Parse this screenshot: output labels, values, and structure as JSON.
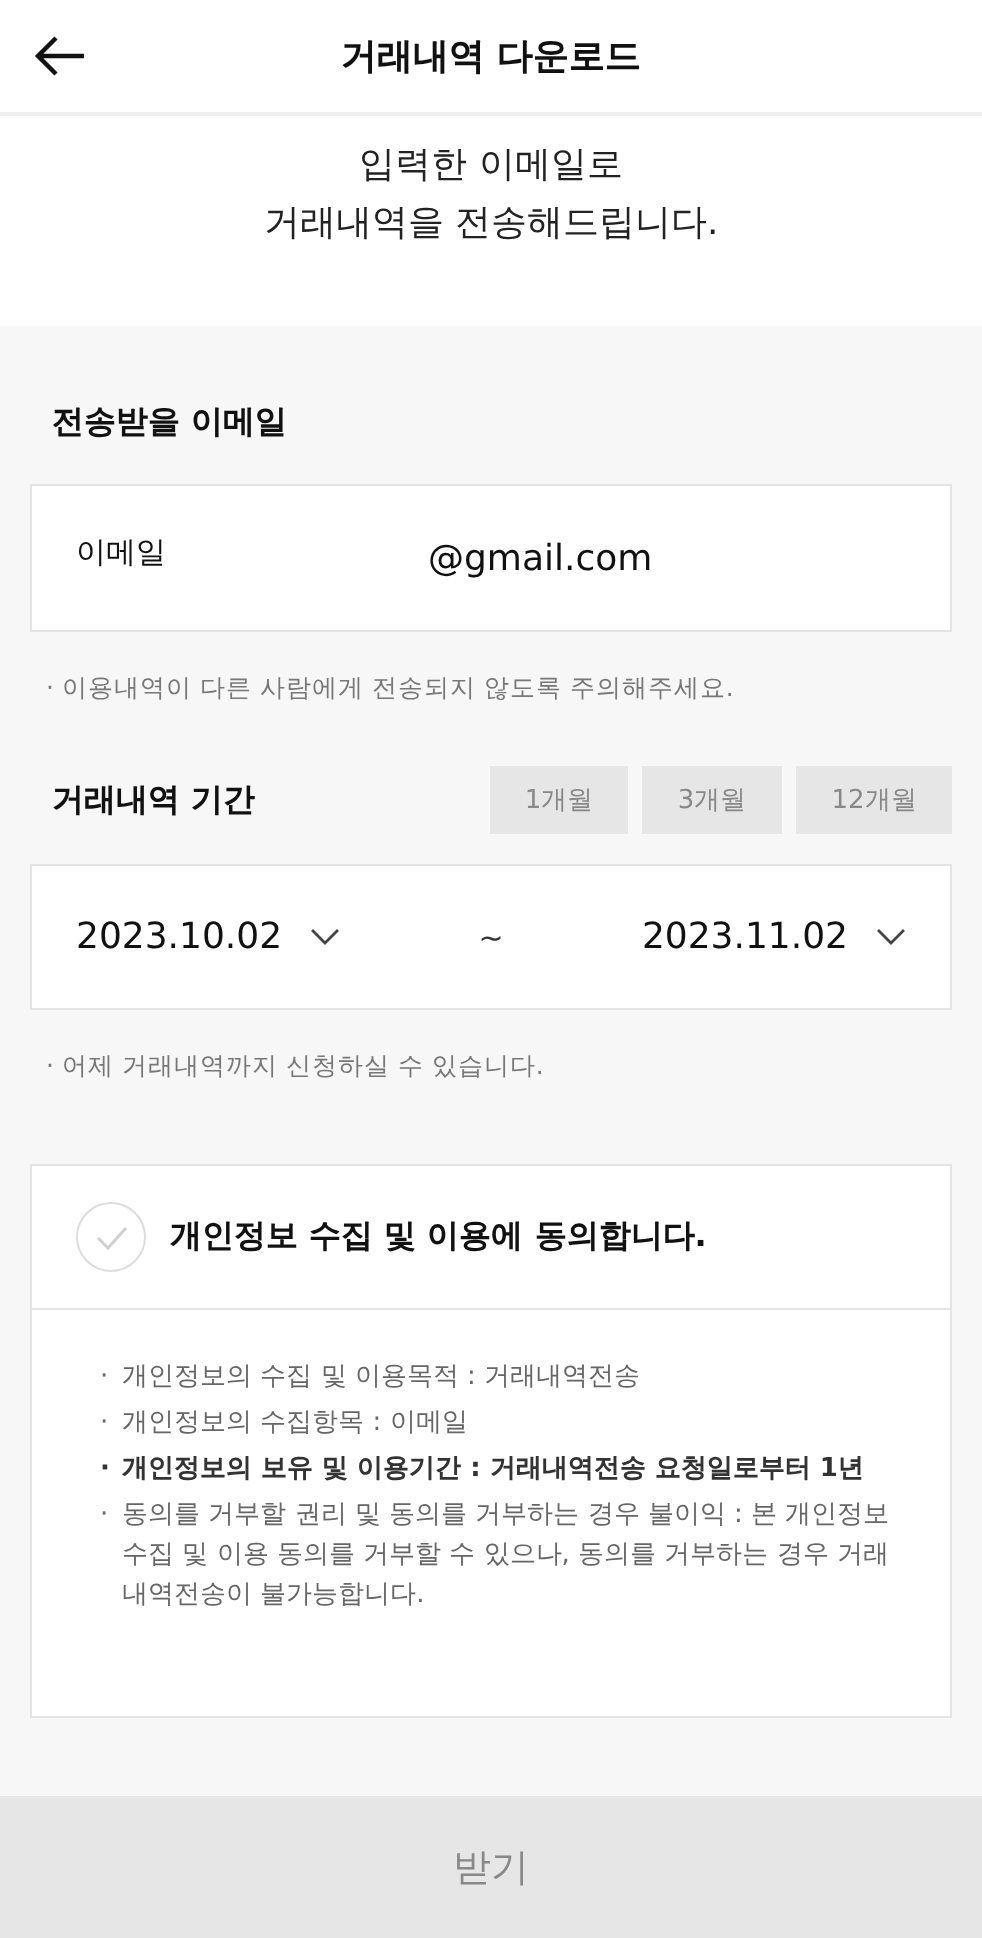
{
  "header": {
    "title": "거래내역 다운로드"
  },
  "intro": [
    "입력한 이메일로",
    "거래내역을 전송해드립니다."
  ],
  "email_section": {
    "title": "전송받을 이메일",
    "label": "이메일",
    "value": "@gmail.com",
    "note": "·  이용내역이 다른 사람에게 전송되지 않도록 주의해주세요."
  },
  "period_section": {
    "title": "거래내역 기간",
    "presets": [
      {
        "label": "1개월",
        "selected": false
      },
      {
        "label": "3개월",
        "selected": false
      },
      {
        "label": "12개월",
        "selected": false
      }
    ],
    "start_date": "2023.10.02",
    "separator": "~",
    "end_date": "2023.11.02",
    "note": "· 어제 거래내역까지 신청하실 수 있습니다."
  },
  "consent": {
    "label": "개인정보 수집 및 이용에 동의합니다.",
    "checked": false,
    "items": [
      {
        "bullet": "·",
        "text": "개인정보의 수집 및 이용목적 : 거래내역전송",
        "emphasis": false
      },
      {
        "bullet": "·",
        "text": "개인정보의 수집항목 : 이메일",
        "emphasis": false
      },
      {
        "bullet": "·",
        "text": "개인정보의 보유 및 이용기간 : 거래내역전송 요청일로부터 1년",
        "emphasis": true
      },
      {
        "bullet": "·",
        "text": "동의를 거부할 권리 및 동의를 거부하는 경우 불이익 : 본 개인정보수집 및 이용 동의를 거부할 수 있으나, 동의를 거부하는 경우 거래내역전송이 불가능합니다.",
        "emphasis": false
      }
    ]
  },
  "submit": {
    "label": "받기",
    "disabled": true
  }
}
